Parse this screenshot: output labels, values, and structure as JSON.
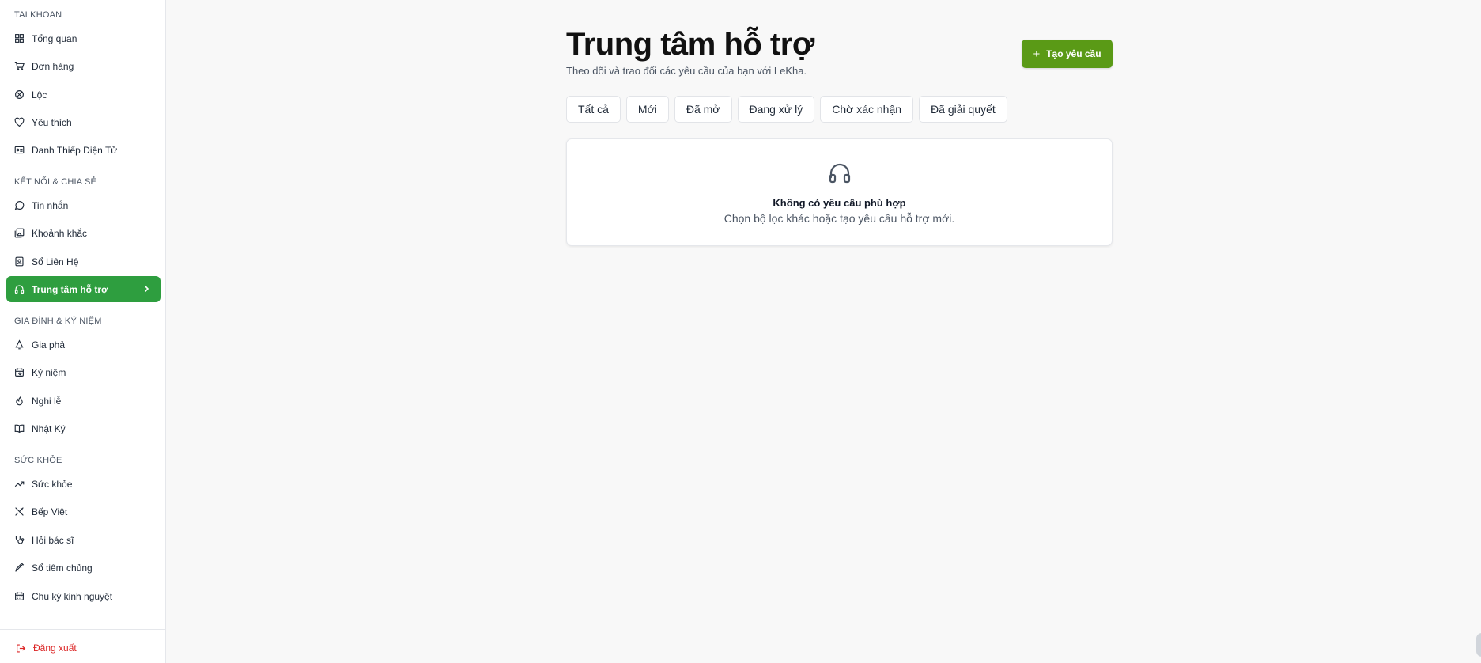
{
  "sidebar": {
    "sections": [
      {
        "title": "TAI KHOAN",
        "items": [
          {
            "label": "Tổng quan",
            "icon": "grid-icon"
          },
          {
            "label": "Đơn hàng",
            "icon": "cart-icon"
          },
          {
            "label": "Lộc",
            "icon": "lotus-icon"
          },
          {
            "label": "Yêu thích",
            "icon": "heart-icon"
          },
          {
            "label": "Danh Thiếp Điện Tử",
            "icon": "id-card-icon"
          }
        ]
      },
      {
        "title": "KẾT NỐI & CHIA SẺ",
        "items": [
          {
            "label": "Tin nhắn",
            "icon": "message-icon"
          },
          {
            "label": "Khoảnh khắc",
            "icon": "gallery-icon"
          },
          {
            "label": "Sổ Liên Hệ",
            "icon": "contact-book-icon"
          },
          {
            "label": "Trung tâm hỗ trợ",
            "icon": "headphones-icon",
            "active": true
          }
        ]
      },
      {
        "title": "GIA ĐÌNH & KỶ NIỆM",
        "items": [
          {
            "label": "Gia phả",
            "icon": "tree-icon"
          },
          {
            "label": "Kỷ niệm",
            "icon": "calendar-heart-icon"
          },
          {
            "label": "Nghi lễ",
            "icon": "flame-icon"
          },
          {
            "label": "Nhật Ký",
            "icon": "book-icon"
          }
        ]
      },
      {
        "title": "SỨC KHỎE",
        "items": [
          {
            "label": "Sức khỏe",
            "icon": "trend-icon"
          },
          {
            "label": "Bếp Việt",
            "icon": "utensils-icon"
          },
          {
            "label": "Hỏi bác sĩ",
            "icon": "stethoscope-icon"
          },
          {
            "label": "Sổ tiêm chủng",
            "icon": "syringe-icon"
          },
          {
            "label": "Chu kỳ kinh nguyệt",
            "icon": "calendar-icon"
          }
        ]
      }
    ],
    "logout_label": "Đăng xuất"
  },
  "main": {
    "title": "Trung tâm hỗ trợ",
    "subtitle": "Theo dõi và trao đổi các yêu cầu của bạn với LeKha.",
    "create_button": "Tạo yêu cầu",
    "filters": [
      "Tất cả",
      "Mới",
      "Đã mở",
      "Đang xử lý",
      "Chờ xác nhận",
      "Đã giải quyết"
    ],
    "empty_state": {
      "title": "Không có yêu cầu phù hợp",
      "description": "Chọn bộ lọc khác hoặc tạo yêu cầu hỗ trợ mới."
    }
  },
  "colors": {
    "accent_active": "#2e9e3f",
    "create_button": "#5a9a16",
    "logout": "#dc2626"
  }
}
